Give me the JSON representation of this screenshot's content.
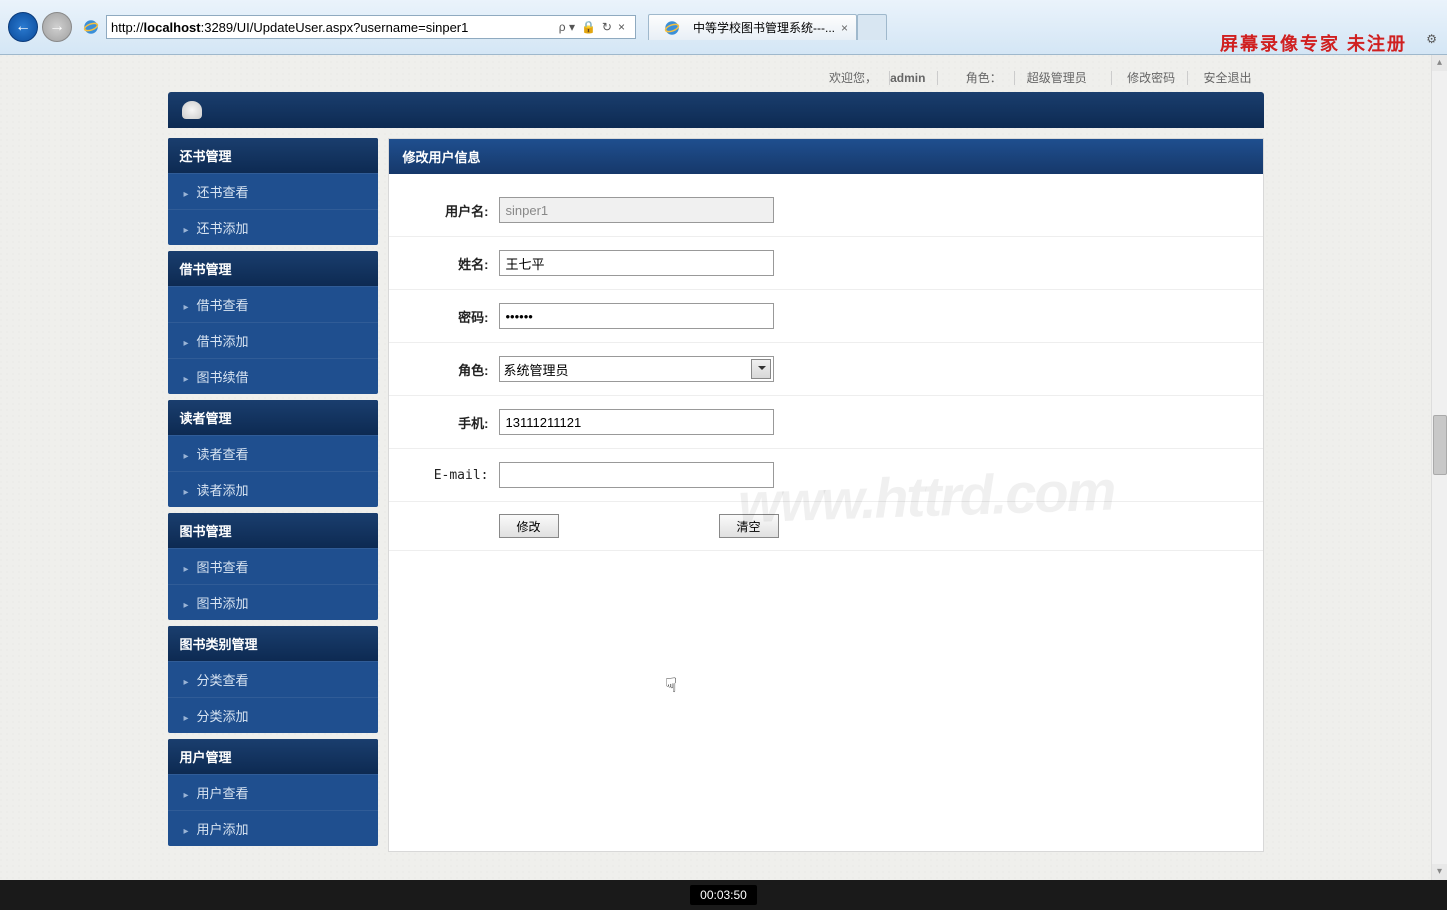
{
  "window": {
    "minimize": "—",
    "maximize": "❐",
    "close": "✕"
  },
  "browser": {
    "url_prefix": "http://",
    "url_host": "localhost",
    "url_port_path": ":3289/UI/UpdateUser.aspx?username=sinper1",
    "search_glyph": "🔍",
    "tab_title": "中等学校图书管理系统---...",
    "tab_close": "×",
    "watermark": "屏幕录像专家 未注册",
    "gear": "⚙",
    "tool_lock": "🔒",
    "tool_refresh": "↻",
    "tool_stop": "×",
    "tool_dropdown": "▾",
    "search_sep": "ρ ▾"
  },
  "toplinks": {
    "welcome_prefix": "欢迎您，",
    "username": "admin",
    "role_prefix": "角色：",
    "role_value": "超级管理员",
    "change_pwd": "修改密码",
    "logout": "安全退出"
  },
  "sidebar": [
    {
      "title": "还书管理",
      "items": [
        "还书查看",
        "还书添加"
      ]
    },
    {
      "title": "借书管理",
      "items": [
        "借书查看",
        "借书添加",
        "图书续借"
      ]
    },
    {
      "title": "读者管理",
      "items": [
        "读者查看",
        "读者添加"
      ]
    },
    {
      "title": "图书管理",
      "items": [
        "图书查看",
        "图书添加"
      ]
    },
    {
      "title": "图书类别管理",
      "items": [
        "分类查看",
        "分类添加"
      ]
    },
    {
      "title": "用户管理",
      "items": [
        "用户查看",
        "用户添加"
      ]
    }
  ],
  "panel": {
    "title": "修改用户信息"
  },
  "form": {
    "username_label": "用户名:",
    "username_value": "sinper1",
    "realname_label": "姓名:",
    "realname_value": "王七平",
    "password_label": "密码:",
    "password_value": "••••••",
    "role_label": "角色:",
    "role_value": "系统管理员",
    "phone_label": "手机:",
    "phone_value": "13111211121",
    "email_label": "E-mail:",
    "email_value": "",
    "submit": "修改",
    "reset": "清空"
  },
  "watermark_center": "www.httrd.com",
  "taskbar_time": "00:03:50"
}
